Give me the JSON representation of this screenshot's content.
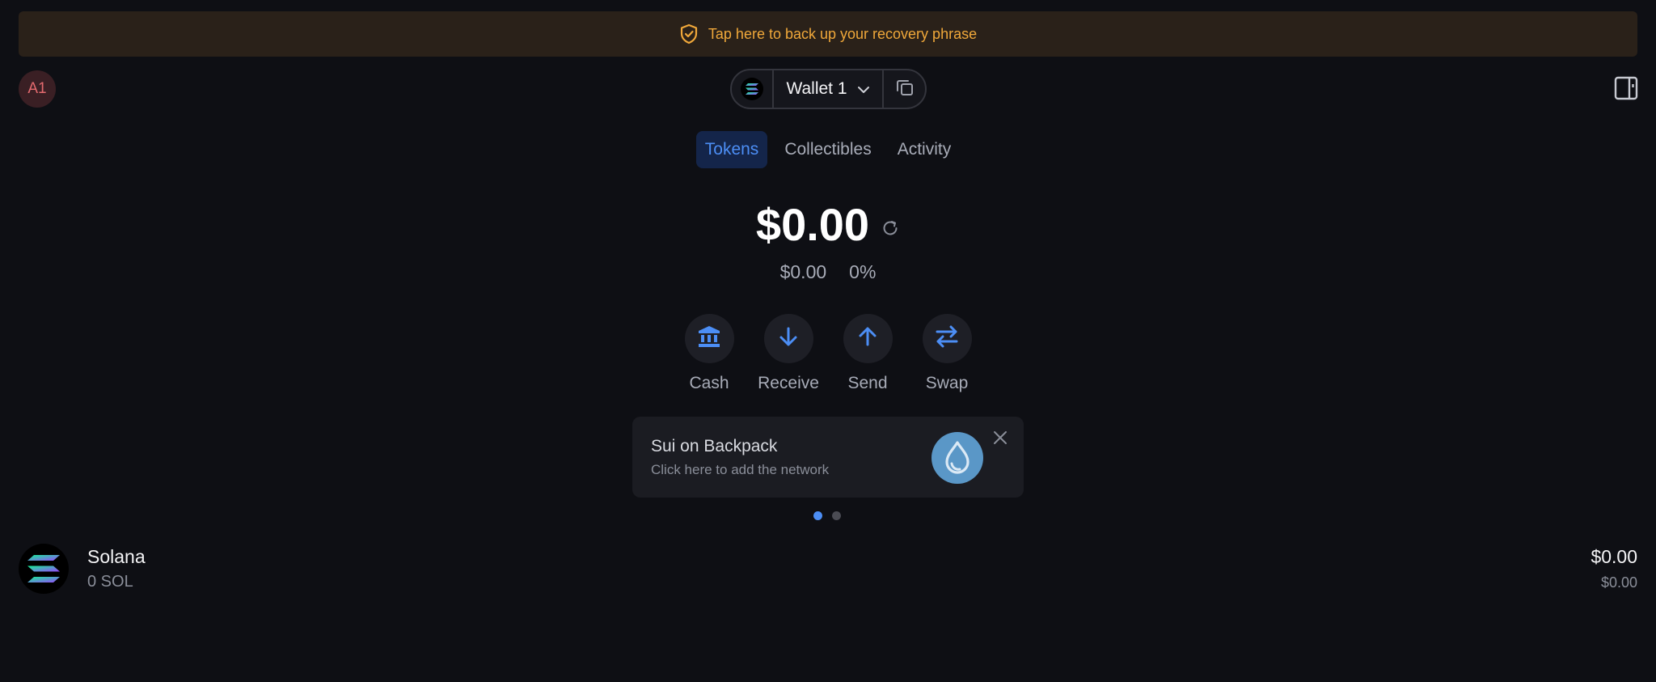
{
  "banner": {
    "text": "Tap here to back up your recovery phrase",
    "icon": "shield-check-icon"
  },
  "header": {
    "avatar_text": "A1",
    "wallet_name": "Wallet 1",
    "network_icon": "solana-icon",
    "copy_icon": "copy-icon",
    "sidepanel_icon": "sidepanel-icon"
  },
  "tabs": [
    {
      "label": "Tokens",
      "active": true
    },
    {
      "label": "Collectibles",
      "active": false
    },
    {
      "label": "Activity",
      "active": false
    }
  ],
  "balance": {
    "total": "$0.00",
    "change_value": "$0.00",
    "change_percent": "0%"
  },
  "actions": [
    {
      "label": "Cash",
      "icon": "bank-icon"
    },
    {
      "label": "Receive",
      "icon": "arrow-down-icon"
    },
    {
      "label": "Send",
      "icon": "arrow-up-icon"
    },
    {
      "label": "Swap",
      "icon": "swap-icon"
    }
  ],
  "promo": {
    "title": "Sui on Backpack",
    "subtitle": "Click here to add the network",
    "icon": "sui-icon",
    "carousel_count": 2,
    "carousel_active_index": 0
  },
  "tokens": [
    {
      "name": "Solana",
      "amount": "0 SOL",
      "value": "$0.00",
      "value_sub": "$0.00",
      "icon": "solana-icon"
    }
  ],
  "colors": {
    "background": "#0e0f14",
    "accent": "#4c8ef5",
    "warning": "#f0a83a"
  }
}
